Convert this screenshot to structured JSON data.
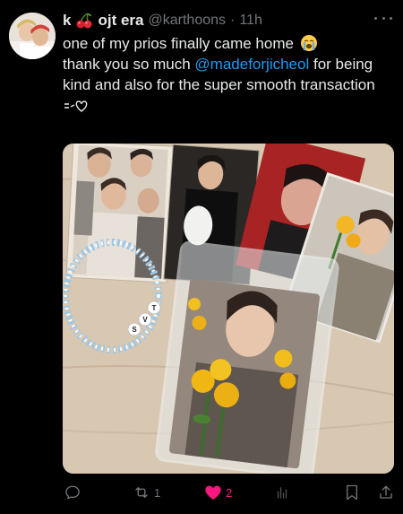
{
  "author": {
    "name": "k",
    "name_suffix": "ojt era",
    "handle": "@karthoons",
    "separator": "·",
    "time": "11h"
  },
  "tweet": {
    "line1": "one of my prios finally came home",
    "line2_prefix": "thank you so much ",
    "mention": "@madeforjicheol",
    "line2_suffix": " for being",
    "line3": "kind and also for the super smooth transaction",
    "icons": [
      "cherries-icon",
      "loudly-crying-face-icon",
      "heart-face-icon"
    ]
  },
  "photo": {
    "bracelet_letters": [
      "S",
      "V",
      "T"
    ]
  },
  "actions": {
    "reply_count": "",
    "retweet_count": "1",
    "like_count": "2",
    "views_count": "",
    "like_color": "#f91880",
    "icons": [
      "reply-icon",
      "retweet-icon",
      "like-icon",
      "views-icon",
      "bookmark-icon",
      "share-icon"
    ]
  },
  "colors": {
    "background": "#000000",
    "text": "#e7e9ea",
    "secondary": "#71767b",
    "mention": "#1d9bf0"
  }
}
